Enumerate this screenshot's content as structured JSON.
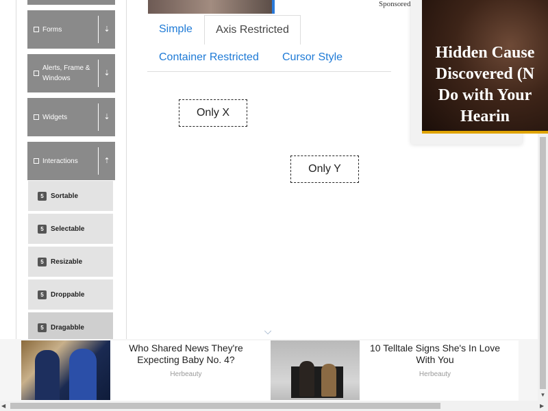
{
  "sidebar": {
    "groups": [
      {
        "label": "Forms",
        "icon": "form-icon"
      },
      {
        "label": "Alerts, Frame & Windows",
        "icon": "window-icon"
      },
      {
        "label": "Widgets",
        "icon": "widgets-icon"
      },
      {
        "label": "Interactions",
        "icon": "interactions-icon"
      }
    ],
    "items": [
      {
        "label": "Sortable",
        "icon": "html5-icon"
      },
      {
        "label": "Selectable",
        "icon": "html5-icon"
      },
      {
        "label": "Resizable",
        "icon": "html5-icon"
      },
      {
        "label": "Droppable",
        "icon": "html5-icon"
      },
      {
        "label": "Dragabble",
        "icon": "html5-icon"
      }
    ],
    "active_item": "Dragabble"
  },
  "top_ad": {
    "sponsored": "Sponsored"
  },
  "tabs": [
    {
      "label": "Simple",
      "active": false
    },
    {
      "label": "Axis Restricted",
      "active": true
    },
    {
      "label": "Container Restricted",
      "active": false
    },
    {
      "label": "Cursor Style",
      "active": false
    }
  ],
  "draggables": {
    "only_x": "Only X",
    "only_y": "Only Y"
  },
  "side_ad": {
    "lines": [
      "Hidden Cause",
      "Discovered (N",
      "Do with Your",
      "Hearin"
    ]
  },
  "bottom_ads": [
    {
      "title": "Who Shared News They're Expecting Baby No. 4?",
      "source": "Herbeauty"
    },
    {
      "title": "10 Telltale Signs She's In Love With You",
      "source": "Herbeauty"
    }
  ],
  "colors": {
    "link": "#1e7ad6",
    "sidebar_group": "#8a8a8a",
    "sidebar_item": "#e3e3e3",
    "sidebar_item_active": "#cfcfcf"
  }
}
